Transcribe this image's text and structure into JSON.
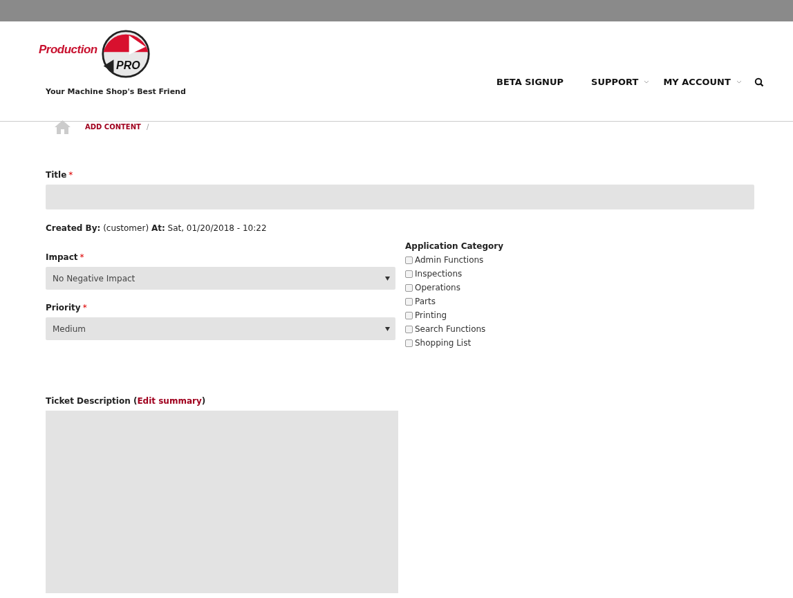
{
  "logo": {
    "word": "Production",
    "badge": "PRO",
    "tagline": "Your Machine Shop's Best Friend"
  },
  "nav": [
    {
      "label": "BETA SIGNUP",
      "dropdown": false
    },
    {
      "label": "SUPPORT",
      "dropdown": true
    },
    {
      "label": "MY ACCOUNT",
      "dropdown": true
    }
  ],
  "breadcrumb": {
    "items": [
      "ADD CONTENT"
    ],
    "separator": "/"
  },
  "form": {
    "title_field": {
      "label": "Title",
      "required_mark": "*"
    },
    "created": "**Created By:** (customer) **At:** Sat, 01/20/2018 - 10:22",
    "selects": [
      {
        "label": "Impact",
        "required_mark": "*",
        "value": "No Negative Impact"
      },
      {
        "label": "Priority",
        "required_mark": "*",
        "value": "Medium"
      }
    ],
    "category": {
      "label": "Application Category",
      "options": [
        {
          "label": "Admin Functions",
          "checked": false
        },
        {
          "label": "Inspections",
          "checked": false
        },
        {
          "label": "Operations",
          "checked": false
        },
        {
          "label": "Parts",
          "checked": false
        },
        {
          "label": "Printing",
          "checked": false
        },
        {
          "label": "Search Functions",
          "checked": false
        },
        {
          "label": "Shopping List",
          "checked": false
        }
      ]
    },
    "description": {
      "prefix": "Ticket Description (",
      "link": "Edit summary",
      "suffix": ")"
    }
  }
}
